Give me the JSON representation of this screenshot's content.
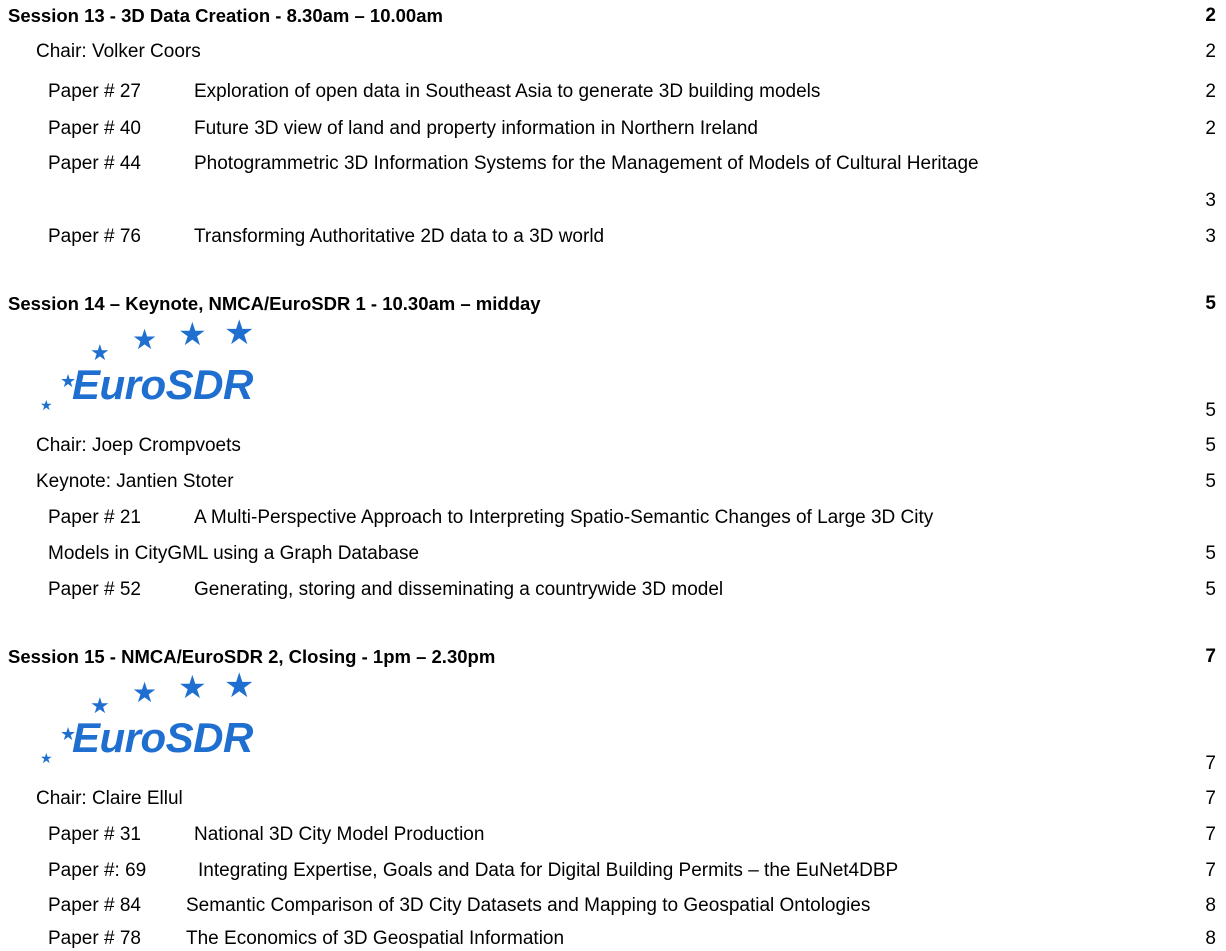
{
  "sessions": [
    {
      "heading": "Session 13 - 3D Data Creation - 8.30am – 10.00am",
      "page": "2",
      "chair": {
        "text": "Chair: Volker Coors",
        "page": "2"
      },
      "papers": [
        {
          "label": "Paper # 27",
          "title": "Exploration of open data in Southeast Asia to generate 3D building models",
          "page": "2"
        },
        {
          "label": "Paper # 40",
          "title": "Future 3D view of land and property information in Northern Ireland",
          "page": "2"
        },
        {
          "label": "Paper # 44",
          "title": "Photogrammetric 3D Information Systems for the Management of Models of Cultural Heritage",
          "page": "3"
        },
        {
          "label": "Paper # 76",
          "title": "Transforming Authoritative 2D data to a 3D world",
          "page": "3"
        }
      ]
    },
    {
      "heading": "Session 14 – Keynote, NMCA/EuroSDR 1 - 10.30am – midday",
      "page": "5",
      "logo": {
        "word": "EuroSDR",
        "page": "5"
      },
      "chair": {
        "text": "Chair: Joep Crompvoets",
        "page": "5"
      },
      "keynote": {
        "text": "Keynote:  Jantien Stoter",
        "page": "5"
      },
      "papers": [
        {
          "label": "Paper # 21",
          "title": "A Multi-Perspective Approach to Interpreting Spatio-Semantic Changes of Large 3D City",
          "continuation": "Models in CityGML using a Graph Database",
          "page": "5"
        },
        {
          "label": "Paper # 52",
          "title": "Generating, storing and disseminating a countrywide 3D model",
          "page": "5"
        }
      ]
    },
    {
      "heading": "Session 15 - NMCA/EuroSDR 2, Closing - 1pm – 2.30pm",
      "page": "7",
      "logo": {
        "word": "EuroSDR",
        "page": "7"
      },
      "chair": {
        "text": "Chair: Claire Ellul",
        "page": "7"
      },
      "papers": [
        {
          "label": "Paper # 31",
          "title": "National 3D City Model Production",
          "page": "7"
        },
        {
          "label": "Paper #: 69",
          "title": "Integrating Expertise, Goals and Data for Digital Building Permits – the EuNet4DBP",
          "page": "7"
        },
        {
          "label": "Paper # 84",
          "title": "Semantic Comparison of 3D City Datasets and Mapping to Geospatial Ontologies",
          "page": "8"
        },
        {
          "label": "Paper # 78",
          "title": "The Economics of 3D Geospatial Information",
          "page": "8"
        }
      ]
    }
  ],
  "colors": {
    "logo_blue": "#1e6fd0",
    "text": "#000000",
    "background": "#ffffff"
  },
  "icons": [
    "star-icon"
  ]
}
